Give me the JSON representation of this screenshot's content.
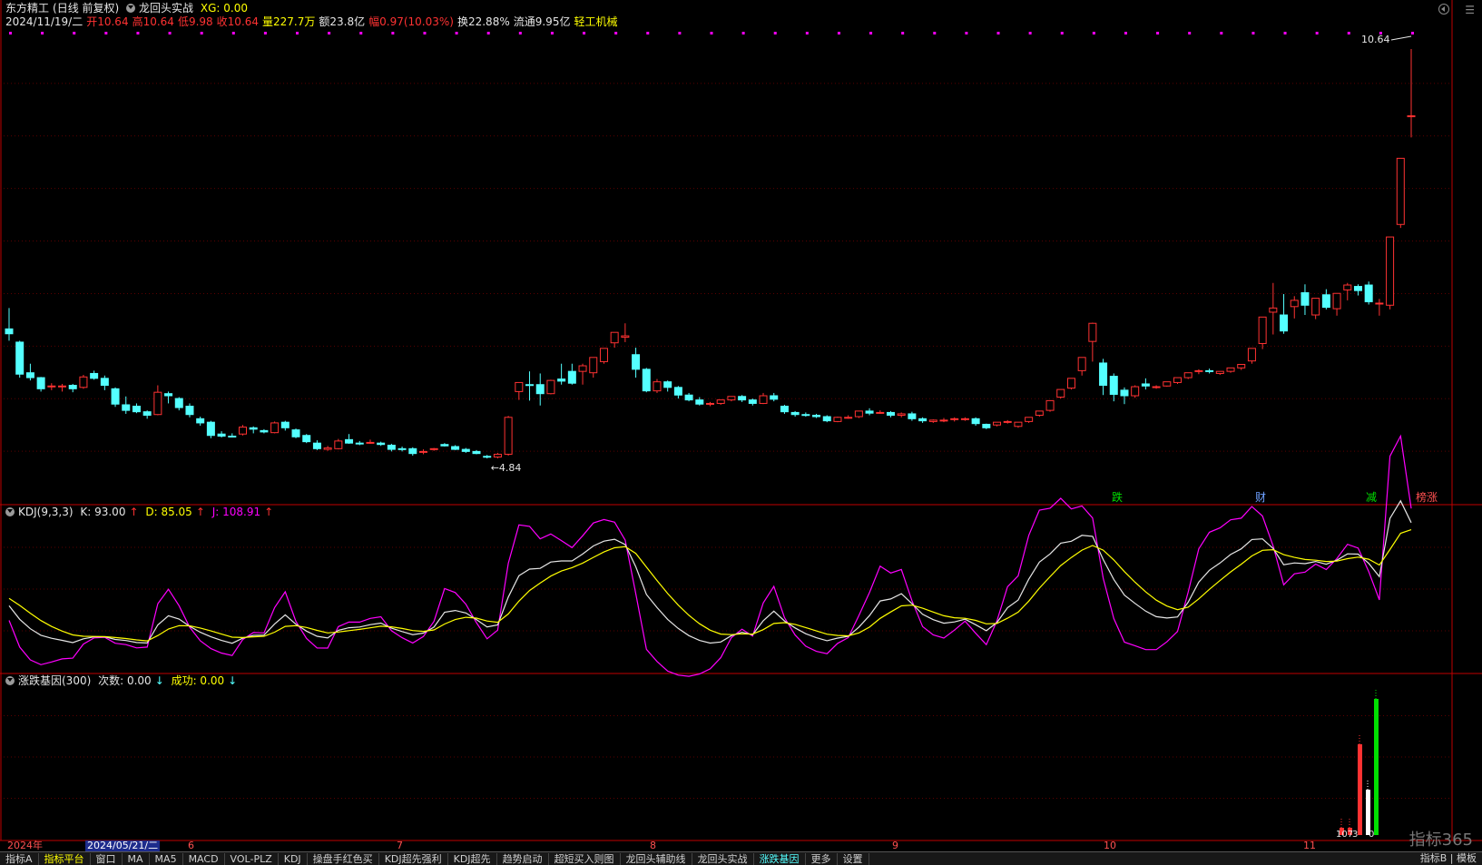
{
  "header": {
    "stock_name": "东方精工",
    "period_label": "(日线 前复权)",
    "indicator_name": "龙回头实战",
    "xg_label": "XG: 0.00",
    "date": "2024/11/19/二",
    "open": "开10.64",
    "high": "高10.64",
    "low": "低9.98",
    "close": "收10.64",
    "volume": "量227.7万",
    "amount": "额23.8亿",
    "change": "幅0.97(10.03%)",
    "turnover": "换22.88%",
    "float": "流通9.95亿",
    "sector": "轻工机械"
  },
  "price_panel": {
    "high_label": "10.64",
    "low_label": "4.84",
    "signal_labels": [
      {
        "text": "跌",
        "color": "#00e000"
      },
      {
        "text": "财",
        "color": "#6ea0ff"
      },
      {
        "text": "减",
        "color": "#00e000"
      },
      {
        "text": "榜涨",
        "color": "#ff5050"
      }
    ]
  },
  "kdj_panel": {
    "title": "KDJ(9,3,3)",
    "k_label": "K: 93.00",
    "d_label": "D: 85.05",
    "j_label": "J: 108.91",
    "arrow": "↑"
  },
  "gene_panel": {
    "title": "涨跌基因(300)",
    "count_label": "次数: 0.00",
    "success_label": "成功: 0.00",
    "arrow": "↓",
    "bar_labels": [
      "107",
      "3",
      "0"
    ]
  },
  "date_axis": {
    "year_label": "2024年",
    "cursor_date": "2024/05/21/二",
    "months": [
      "6",
      "7",
      "8",
      "9",
      "10",
      "11"
    ]
  },
  "tabs": [
    "指标A",
    "指标平台",
    "窗口",
    "MA",
    "MA5",
    "MACD",
    "VOL-PLZ",
    "KDJ",
    "操盘手红色买",
    "KDJ超先强利",
    "KDJ超先",
    "趋势启动",
    "超短买入则图",
    "龙回头辅助线",
    "龙回头实战",
    "涨跌基因",
    "更多",
    "设置"
  ],
  "active_tab": "指标平台",
  "selected_tab": "涨跌基因",
  "right_tabs": [
    "指标B",
    "模板"
  ],
  "watermark": "指标365",
  "chart_data": {
    "type": "candlestick",
    "title": "东方精工 (日线 前复权)",
    "ohlc": [
      [
        6.62,
        6.92,
        6.55,
        6.45
      ],
      [
        6.43,
        6.45,
        5.97,
        5.92
      ],
      [
        5.99,
        6.12,
        5.92,
        5.88
      ],
      [
        5.92,
        5.93,
        5.76,
        5.72
      ],
      [
        5.79,
        5.84,
        5.8,
        5.74
      ],
      [
        5.79,
        5.83,
        5.8,
        5.72
      ],
      [
        5.81,
        5.83,
        5.76,
        5.71
      ],
      [
        5.78,
        5.96,
        5.93,
        5.76
      ],
      [
        5.98,
        6.02,
        5.91,
        5.89
      ],
      [
        5.91,
        5.95,
        5.81,
        5.74
      ],
      [
        5.76,
        5.78,
        5.54,
        5.5
      ],
      [
        5.53,
        5.65,
        5.45,
        5.4
      ],
      [
        5.51,
        5.55,
        5.43,
        5.41
      ],
      [
        5.43,
        5.45,
        5.38,
        5.33
      ],
      [
        5.39,
        5.81,
        5.71,
        5.38
      ],
      [
        5.69,
        5.72,
        5.66,
        5.55
      ],
      [
        5.62,
        5.64,
        5.49,
        5.45
      ],
      [
        5.51,
        5.55,
        5.39,
        5.35
      ],
      [
        5.33,
        5.36,
        5.27,
        5.23
      ],
      [
        5.28,
        5.3,
        5.09,
        5.05
      ],
      [
        5.11,
        5.15,
        5.08,
        5.06
      ],
      [
        5.08,
        5.12,
        5.07,
        5.06
      ],
      [
        5.11,
        5.24,
        5.21,
        5.09
      ],
      [
        5.2,
        5.22,
        5.18,
        5.12
      ],
      [
        5.16,
        5.18,
        5.14,
        5.12
      ],
      [
        5.13,
        5.29,
        5.27,
        5.12
      ],
      [
        5.28,
        5.3,
        5.2,
        5.16
      ],
      [
        5.17,
        5.19,
        5.07,
        5.05
      ],
      [
        5.09,
        5.11,
        5.0,
        4.98
      ],
      [
        4.98,
        5.02,
        4.9,
        4.88
      ],
      [
        4.89,
        4.94,
        4.91,
        4.87
      ],
      [
        4.9,
        5.04,
        5.01,
        4.89
      ],
      [
        5.03,
        5.11,
        4.98,
        4.97
      ],
      [
        4.98,
        5.01,
        4.97,
        4.95
      ],
      [
        4.98,
        5.03,
        4.99,
        4.97
      ],
      [
        4.98,
        5.0,
        4.96,
        4.94
      ],
      [
        4.95,
        4.97,
        4.89,
        4.86
      ],
      [
        4.9,
        4.93,
        4.89,
        4.86
      ],
      [
        4.9,
        4.92,
        4.83,
        4.8
      ],
      [
        4.85,
        4.89,
        4.86,
        4.82
      ],
      [
        4.89,
        4.91,
        4.9,
        4.87
      ],
      [
        4.96,
        4.98,
        4.94,
        4.93
      ],
      [
        4.93,
        4.95,
        4.89,
        4.88
      ],
      [
        4.89,
        4.91,
        4.86,
        4.84
      ],
      [
        4.86,
        4.88,
        4.83,
        4.82
      ],
      [
        4.79,
        4.81,
        4.78,
        4.76
      ],
      [
        4.78,
        4.84,
        4.82,
        4.76
      ],
      [
        4.82,
        5.37,
        5.35,
        4.8
      ],
      [
        5.72,
        5.81,
        5.85,
        5.6
      ],
      [
        5.82,
        6.01,
        5.81,
        5.59
      ],
      [
        5.82,
        5.98,
        5.69,
        5.52
      ],
      [
        5.69,
        5.89,
        5.88,
        5.68
      ],
      [
        5.9,
        6.12,
        5.87,
        5.82
      ],
      [
        6.01,
        6.12,
        5.84,
        5.82
      ],
      [
        6.01,
        6.12,
        6.09,
        5.82
      ],
      [
        5.99,
        6.12,
        6.21,
        5.92
      ],
      [
        6.15,
        6.3,
        6.34,
        6.12
      ],
      [
        6.42,
        6.55,
        6.57,
        6.35
      ],
      [
        6.5,
        6.7,
        6.52,
        6.43
      ],
      [
        6.25,
        6.35,
        6.04,
        5.92
      ],
      [
        6.04,
        6.06,
        5.73,
        5.71
      ],
      [
        5.73,
        5.9,
        5.86,
        5.7
      ],
      [
        5.86,
        5.88,
        5.78,
        5.72
      ],
      [
        5.78,
        5.8,
        5.67,
        5.62
      ],
      [
        5.67,
        5.7,
        5.6,
        5.58
      ],
      [
        5.6,
        5.64,
        5.54,
        5.52
      ],
      [
        5.54,
        5.57,
        5.55,
        5.51
      ],
      [
        5.55,
        5.59,
        5.6,
        5.53
      ],
      [
        5.6,
        5.64,
        5.65,
        5.58
      ],
      [
        5.65,
        5.67,
        5.6,
        5.57
      ],
      [
        5.6,
        5.62,
        5.55,
        5.52
      ],
      [
        5.55,
        5.7,
        5.66,
        5.54
      ],
      [
        5.66,
        5.7,
        5.61,
        5.58
      ],
      [
        5.51,
        5.53,
        5.43,
        5.4
      ],
      [
        5.42,
        5.44,
        5.39,
        5.36
      ],
      [
        5.39,
        5.42,
        5.38,
        5.36
      ],
      [
        5.38,
        5.4,
        5.36,
        5.34
      ],
      [
        5.36,
        5.38,
        5.3,
        5.28
      ],
      [
        5.29,
        5.36,
        5.35,
        5.28
      ],
      [
        5.35,
        5.38,
        5.35,
        5.33
      ],
      [
        5.36,
        5.4,
        5.44,
        5.34
      ],
      [
        5.44,
        5.48,
        5.41,
        5.38
      ],
      [
        5.42,
        5.45,
        5.42,
        5.4
      ],
      [
        5.42,
        5.44,
        5.38,
        5.35
      ],
      [
        5.38,
        5.42,
        5.4,
        5.35
      ],
      [
        5.4,
        5.43,
        5.33,
        5.3
      ],
      [
        5.33,
        5.35,
        5.3,
        5.27
      ],
      [
        5.29,
        5.32,
        5.31,
        5.27
      ],
      [
        5.31,
        5.34,
        5.31,
        5.28
      ],
      [
        5.32,
        5.35,
        5.33,
        5.29
      ],
      [
        5.32,
        5.35,
        5.33,
        5.3
      ],
      [
        5.33,
        5.35,
        5.26,
        5.23
      ],
      [
        5.25,
        5.26,
        5.2,
        5.18
      ],
      [
        5.24,
        5.28,
        5.28,
        5.22
      ],
      [
        5.28,
        5.31,
        5.29,
        5.26
      ],
      [
        5.22,
        5.28,
        5.28,
        5.2
      ],
      [
        5.29,
        5.35,
        5.35,
        5.27
      ],
      [
        5.38,
        5.42,
        5.44,
        5.36
      ],
      [
        5.45,
        5.59,
        5.59,
        5.43
      ],
      [
        5.64,
        5.68,
        5.75,
        5.62
      ],
      [
        5.77,
        5.91,
        5.91,
        5.75
      ],
      [
        6.02,
        6.1,
        6.21,
        5.95
      ],
      [
        6.44,
        6.71,
        6.7,
        6.15
      ],
      [
        6.13,
        6.19,
        5.81,
        5.67
      ],
      [
        5.94,
        5.98,
        5.68,
        5.58
      ],
      [
        5.74,
        5.78,
        5.66,
        5.54
      ],
      [
        5.66,
        5.81,
        5.79,
        5.63
      ],
      [
        5.83,
        5.91,
        5.8,
        5.75
      ],
      [
        5.79,
        5.81,
        5.79,
        5.76
      ],
      [
        5.8,
        5.86,
        5.86,
        5.79
      ],
      [
        5.85,
        5.92,
        5.92,
        5.83
      ],
      [
        5.92,
        5.99,
        5.99,
        5.9
      ],
      [
        6.01,
        6.04,
        6.02,
        5.97
      ],
      [
        6.02,
        6.05,
        6.01,
        5.98
      ],
      [
        5.98,
        6.01,
        6.01,
        5.96
      ],
      [
        6.01,
        6.06,
        6.06,
        5.99
      ],
      [
        6.06,
        6.11,
        6.11,
        6.03
      ],
      [
        6.16,
        6.27,
        6.34,
        6.12
      ],
      [
        6.41,
        6.79,
        6.79,
        6.33
      ],
      [
        6.86,
        7.28,
        6.92,
        6.54
      ],
      [
        6.82,
        7.12,
        6.59,
        6.55
      ],
      [
        6.94,
        7.09,
        7.03,
        6.77
      ],
      [
        7.14,
        7.26,
        6.96,
        6.82
      ],
      [
        6.82,
        7.05,
        7.06,
        6.76
      ],
      [
        7.11,
        7.19,
        6.93,
        6.9
      ],
      [
        6.91,
        7.01,
        7.13,
        6.81
      ],
      [
        7.18,
        7.28,
        7.25,
        7.03
      ],
      [
        7.23,
        7.26,
        7.17,
        7.1
      ],
      [
        7.25,
        7.3,
        7.01,
        6.97
      ],
      [
        6.99,
        7.05,
        6.99,
        6.81
      ],
      [
        6.96,
        7.15,
        7.94,
        6.9
      ],
      [
        8.12,
        8.18,
        9.07,
        8.07
      ],
      [
        9.68,
        10.64,
        9.68,
        9.37
      ]
    ],
    "ylim": [
      4.5,
      10.9
    ]
  }
}
